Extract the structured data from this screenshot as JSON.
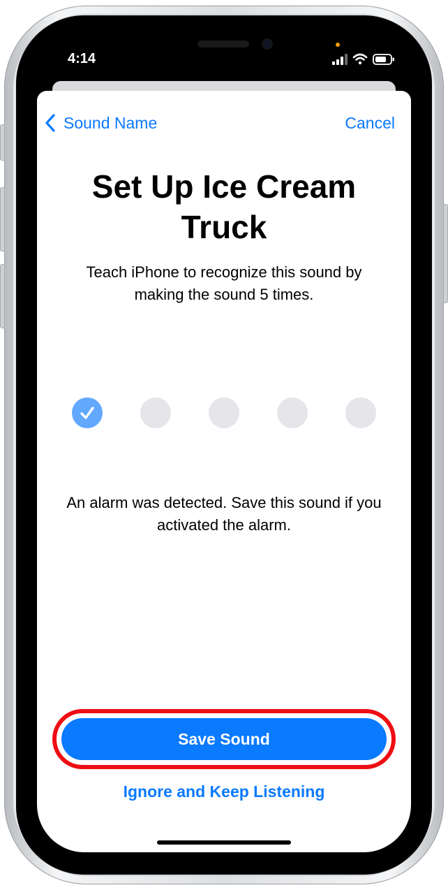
{
  "status_bar": {
    "time": "4:14",
    "icons": [
      "signal-icon",
      "wifi-icon",
      "battery-icon"
    ]
  },
  "nav": {
    "back_label": "Sound Name",
    "cancel_label": "Cancel"
  },
  "content": {
    "title": "Set Up Ice Cream Truck",
    "subtitle": "Teach iPhone to recognize this sound by making the sound 5 times.",
    "progress": {
      "completed": 1,
      "total": 5
    },
    "message": "An alarm was detected. Save this sound if you activated the alarm."
  },
  "actions": {
    "save_label": "Save Sound",
    "ignore_label": "Ignore and Keep Listening"
  },
  "colors": {
    "accent": "#0a7aff",
    "highlight": "#ee0f14",
    "progress_done": "#62a8ff",
    "progress_pending": "#e5e5ea"
  }
}
